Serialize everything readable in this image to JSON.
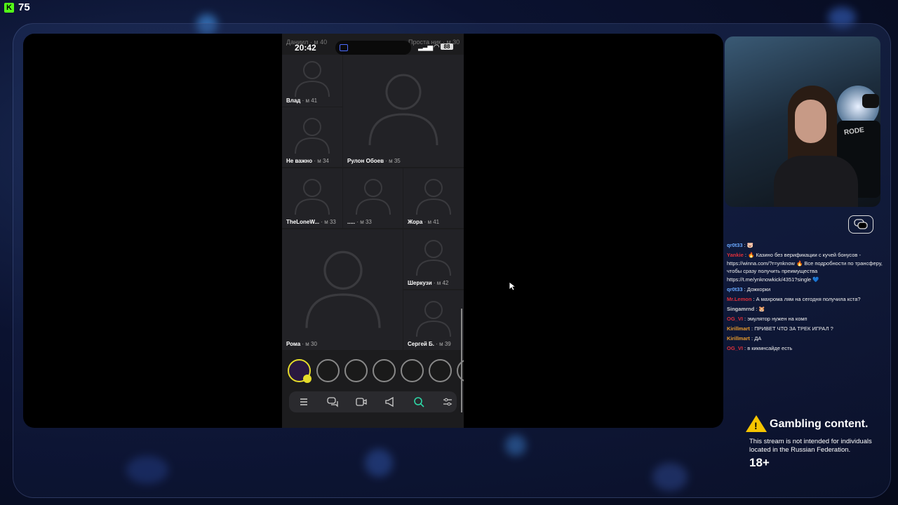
{
  "viewer_count": "75",
  "phone": {
    "status_time": "20:42",
    "battery": "88",
    "ghost_left": "Даниил · м 40",
    "ghost_right": "Проста ник · м 30"
  },
  "profiles": [
    {
      "name": "Влад",
      "meta": "· м 41"
    },
    {
      "name": "Рулон Обоев",
      "meta": "· м 35"
    },
    {
      "name": "Не важно",
      "meta": "· м 34"
    },
    {
      "name": "TheLoneW...",
      "meta": "· м 33"
    },
    {
      "name": ".....",
      "meta": "· м 33"
    },
    {
      "name": "Жора",
      "meta": "· м 41"
    },
    {
      "name": "Шеркузи",
      "meta": "· м 42"
    },
    {
      "name": "Рома",
      "meta": "· м 30"
    },
    {
      "name": "Сергей Б.",
      "meta": "· м 39"
    }
  ],
  "nav_icons": [
    "menu-icon",
    "chats-icon",
    "video-icon",
    "megaphone-icon",
    "search-icon",
    "filter-icon"
  ],
  "chat": [
    {
      "user": "qr0t33",
      "text": ": 🐷",
      "color": "#6aa9ff"
    },
    {
      "user": "Yankie",
      "text": ": 🔥 Казино без верификации с кучей бонусов - https://winna.com/?r=ynknow 🔥 Все подробности по трансферу, чтобы сразу получить преимущества https://t.me/ynknowkick/4351?single 💙",
      "color": "#e0303a"
    },
    {
      "user": "qr0t33",
      "text": ": Дожкорки",
      "color": "#6aa9ff"
    },
    {
      "user": "Mr.Lemon",
      "text": ": А махрома лям на сегодня получила кста?",
      "color": "#e0303a"
    },
    {
      "user": "Singamrnd",
      "text": ": 🐹",
      "color": "#cfcfcf"
    },
    {
      "user": "OG_VI",
      "text": ": эмулятор нужен на комп",
      "color": "#e0303a"
    },
    {
      "user": "Kirillmart",
      "text": ": ПРИВЕТ ЧТО ЗА ТРЕК ИГРАЛ ?",
      "color": "#e89a2c"
    },
    {
      "user": "Kirillmart",
      "text": ": ДА",
      "color": "#e89a2c"
    },
    {
      "user": "OG_VI",
      "text": ": в кикмнсайде есть",
      "color": "#e0303a"
    }
  ],
  "gambling": {
    "title": "Gambling content.",
    "description": "This stream is not intended for individuals located in the Russian Federation.",
    "age": "18+"
  },
  "webcam_label": "RODE"
}
